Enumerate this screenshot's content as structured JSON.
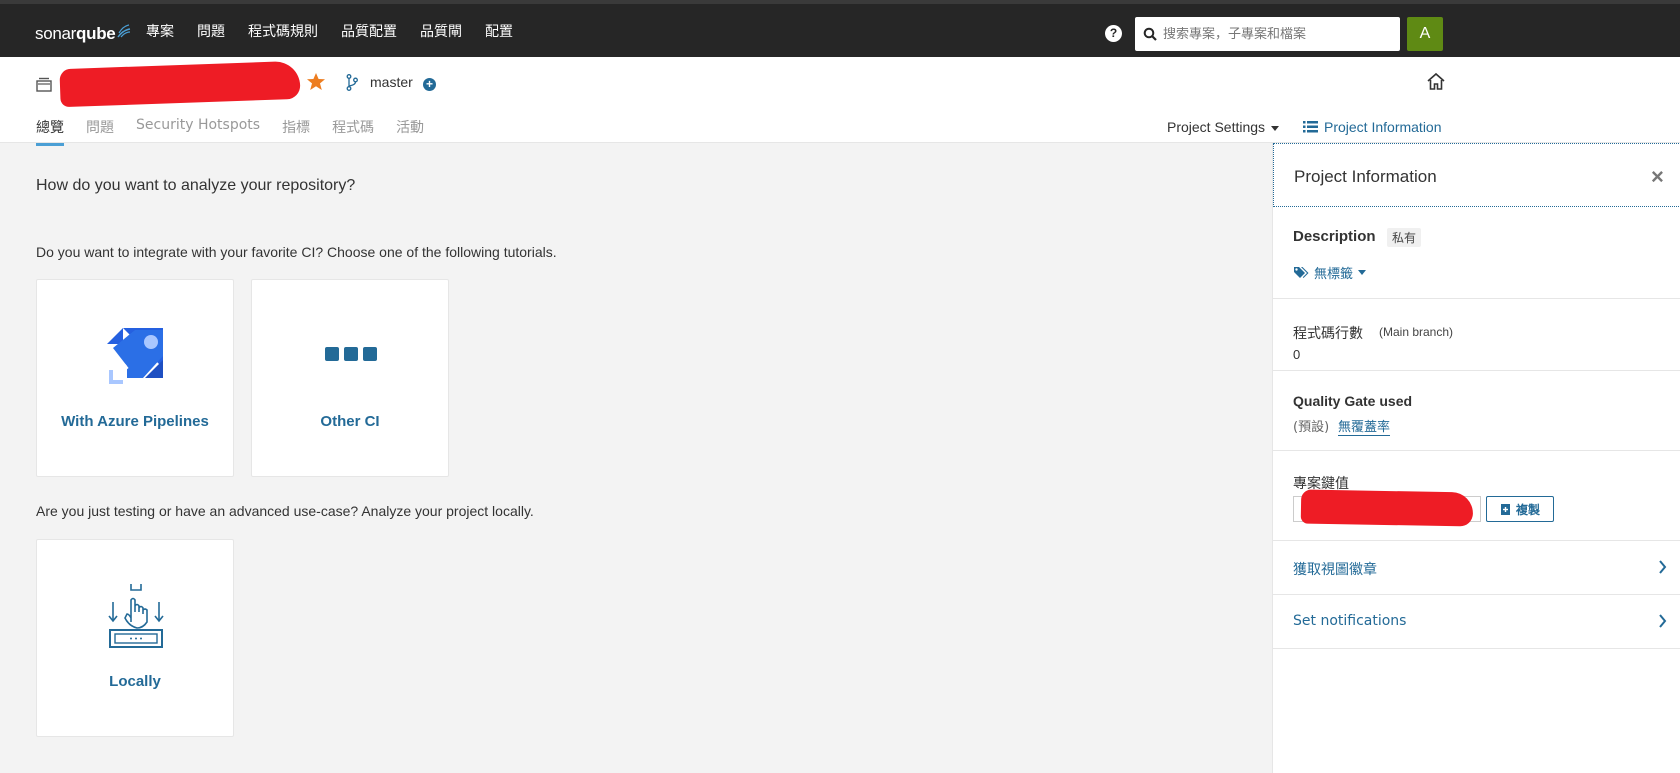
{
  "nav": {
    "logo_light": "sonar",
    "logo_bold": "qube",
    "items": [
      "專案",
      "問題",
      "程式碼規則",
      "品質配置",
      "品質閘",
      "配置"
    ],
    "search_placeholder": "搜索專案，子專案和檔案",
    "avatar_letter": "A",
    "help_icon": "question-circle-icon"
  },
  "project": {
    "branch": "master"
  },
  "tabs": [
    "總覽",
    "問題",
    "Security Hotspots",
    "指標",
    "程式碼",
    "活動"
  ],
  "actions": {
    "project_settings": "Project Settings",
    "project_information": "Project Information"
  },
  "main": {
    "question": "How do you want to analyze your repository?",
    "ci_prompt": "Do you want to integrate with your favorite CI? Choose one of the following tutorials.",
    "cards": [
      {
        "label": "With Azure Pipelines",
        "icon": "azure-pipelines-icon"
      },
      {
        "label": "Other CI",
        "icon": "other-ci-icon"
      }
    ],
    "local_prompt": "Are you just testing or have an advanced use-case? Analyze your project locally.",
    "local_card": {
      "label": "Locally",
      "icon": "locally-icon"
    }
  },
  "sidebar": {
    "title": "Project Information",
    "description_label": "Description",
    "private_badge": "私有",
    "tags_label": "無標籤",
    "loc_label": "程式碼行數",
    "loc_sub": "(Main branch)",
    "loc_value": "0",
    "qg_label": "Quality Gate used",
    "qg_default": "(預設)",
    "qg_name": "無覆蓋率",
    "key_label": "專案鍵值",
    "copy_label": "複製",
    "badges_link": "獲取視圖徽章",
    "notifications_link": "Set notifications"
  },
  "colors": {
    "nav_bg": "#262626",
    "link": "#236a97",
    "tab_active_border": "#4b9fd5",
    "avatar": "#5f8a14",
    "star": "#ed7d20"
  }
}
